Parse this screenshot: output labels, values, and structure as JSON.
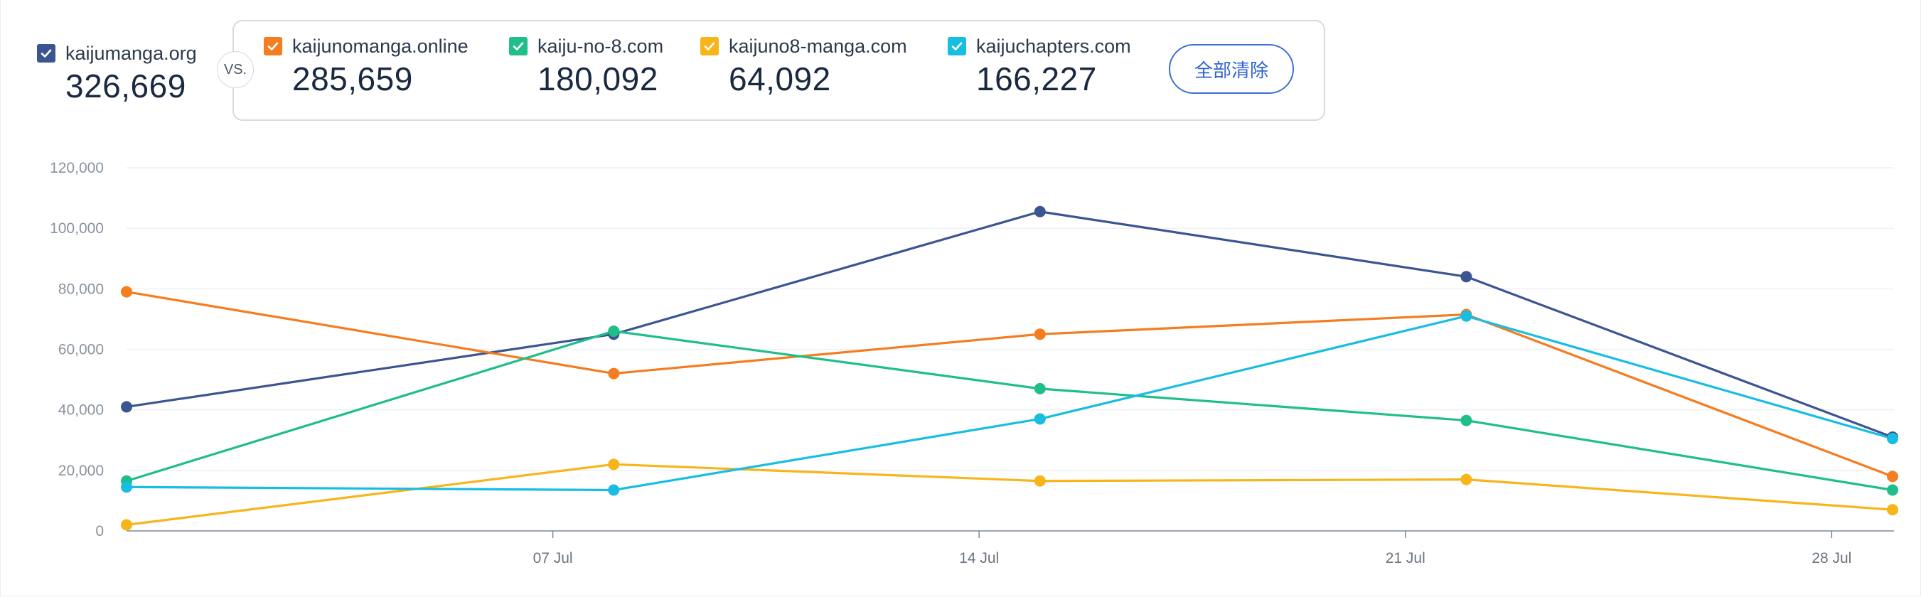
{
  "header": {
    "main_site": {
      "name": "kaijumanga.org",
      "value": "326,669",
      "color": "#3b5591"
    },
    "vs_label": "VS.",
    "compare_sites": [
      {
        "name": "kaijunomanga.online",
        "value": "285,659",
        "color": "#f57c1f"
      },
      {
        "name": "kaiju-no-8.com",
        "value": "180,092",
        "color": "#1fbe8a"
      },
      {
        "name": "kaijuno8-manga.com",
        "value": "64,092",
        "color": "#f7b51a"
      },
      {
        "name": "kaijuchapters.com",
        "value": "166,227",
        "color": "#18bde2"
      }
    ],
    "clear_all_label": "全部清除"
  },
  "chart_data": {
    "type": "line",
    "x_dates": [
      "2024-06-30",
      "2024-07-08",
      "2024-07-15",
      "2024-07-22",
      "2024-07-29"
    ],
    "x_tick_labels": [
      {
        "date": "2024-07-07",
        "label": "07 Jul"
      },
      {
        "date": "2024-07-14",
        "label": "14 Jul"
      },
      {
        "date": "2024-07-21",
        "label": "21 Jul"
      },
      {
        "date": "2024-07-28",
        "label": "28 Jul"
      }
    ],
    "ylim": [
      0,
      120000
    ],
    "y_ticks": [
      0,
      20000,
      40000,
      60000,
      80000,
      100000,
      120000
    ],
    "y_tick_labels": [
      "0",
      "20,000",
      "40,000",
      "60,000",
      "80,000",
      "100,000",
      "120,000"
    ],
    "grid": true,
    "series": [
      {
        "name": "kaijumanga.org",
        "color": "#3b5591",
        "values": [
          41000,
          65000,
          105500,
          84000,
          31000
        ]
      },
      {
        "name": "kaijunomanga.online",
        "color": "#f57c1f",
        "values": [
          79000,
          52000,
          65000,
          71500,
          18000
        ]
      },
      {
        "name": "kaiju-no-8.com",
        "color": "#1fbe8a",
        "values": [
          16500,
          66000,
          47000,
          36500,
          13500
        ]
      },
      {
        "name": "kaijuno8-manga.com",
        "color": "#f7b51a",
        "values": [
          2000,
          22000,
          16500,
          17000,
          7000
        ]
      },
      {
        "name": "kaijuchapters.com",
        "color": "#18bde2",
        "values": [
          14500,
          13500,
          37000,
          71000,
          30500
        ]
      }
    ]
  }
}
